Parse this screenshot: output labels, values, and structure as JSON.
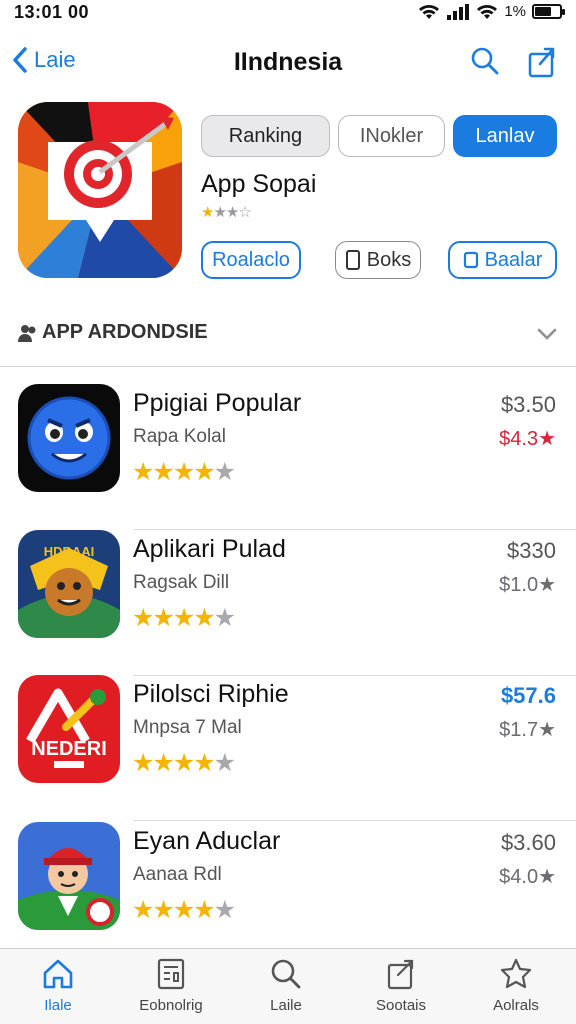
{
  "status_bar": {
    "time": "13:01 00",
    "battery": "1%"
  },
  "nav": {
    "back_label": "Laie",
    "title": "IIndnesia"
  },
  "hero": {
    "segments": [
      "Ranking",
      "INokler",
      "Lanlav"
    ],
    "app_name": "App Sopai",
    "rating_stars": "★★☆☆",
    "actions": [
      "Roalaclo",
      "Boks",
      "Baalar"
    ]
  },
  "section": {
    "title": "APP ARDONDSIE"
  },
  "apps": [
    {
      "name": "Ppigiai Popular",
      "subtitle": "Rapa Kolal",
      "price": "$3.50",
      "price2": "$4.3★",
      "stars_filled": 4
    },
    {
      "name": "Aplikari Pulad",
      "subtitle": "Ragsak Dill",
      "price": "$330",
      "price2": "$1.0★",
      "stars_filled": 4
    },
    {
      "name": "Pilolsci Riphie",
      "subtitle": "Mnpsa 7 Mal",
      "price": "$57.6",
      "price2": "$1.7★",
      "stars_filled": 4
    },
    {
      "name": "Eyan Aduclar",
      "subtitle": "Aanaa Rdl",
      "price": "$3.60",
      "price2": "$4.0★",
      "stars_filled": 4
    }
  ],
  "tabs": [
    "Ilale",
    "Eobnolrig",
    "Laile",
    "Sootais",
    "Aolrals"
  ],
  "colors": {
    "accent": "#1a7be0",
    "star": "#f4b400",
    "red_price": "#d8243c"
  }
}
